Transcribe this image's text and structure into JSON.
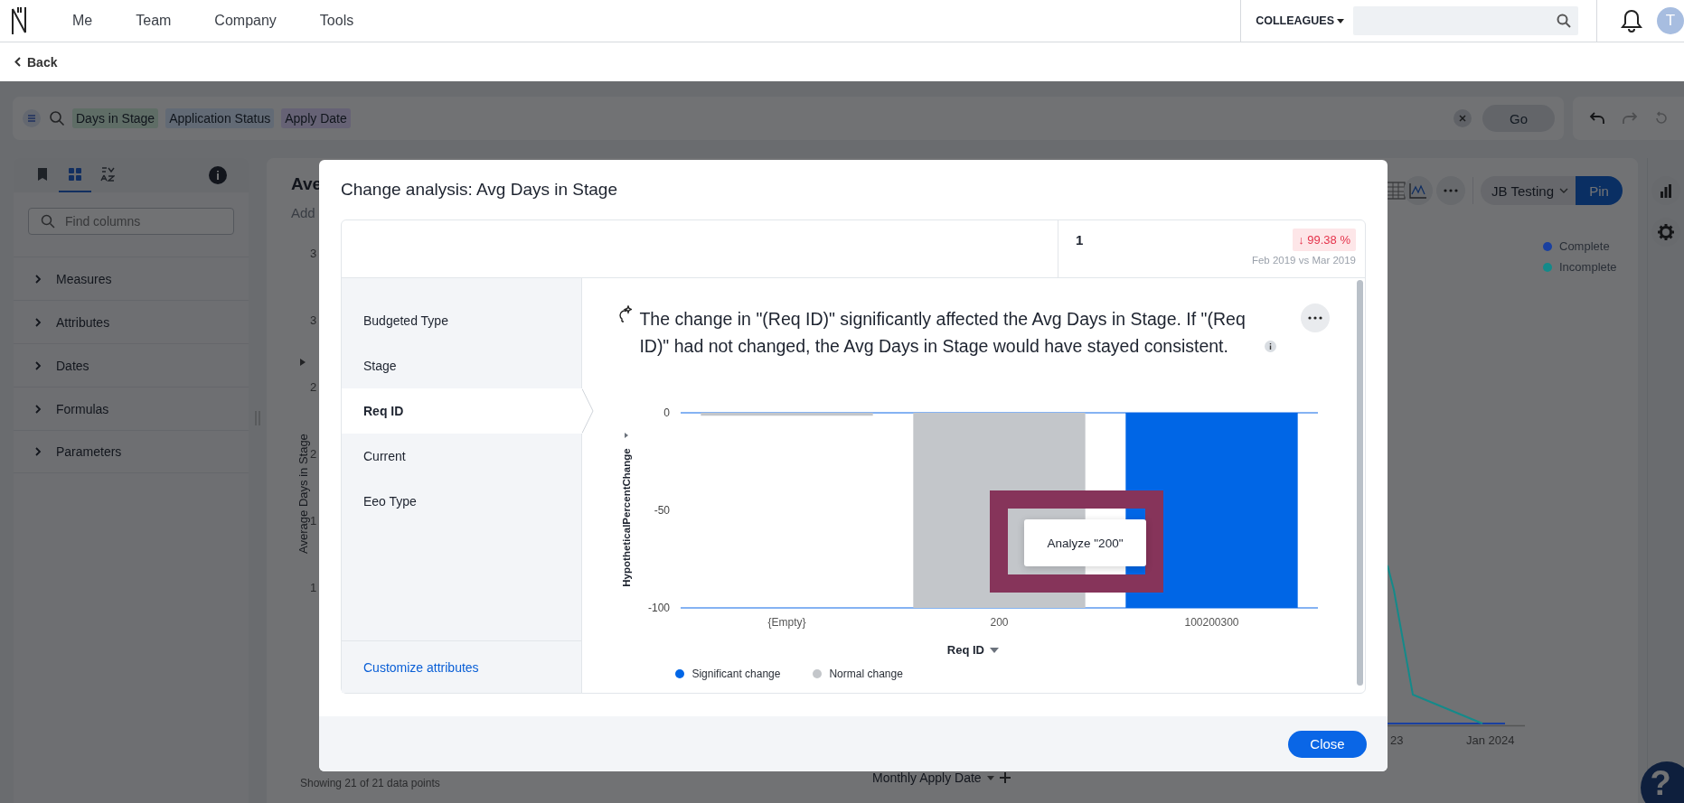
{
  "top_nav": {
    "menu": [
      "Me",
      "Team",
      "Company",
      "Tools"
    ],
    "colleagues": "COLLEAGUES",
    "avatar": "T"
  },
  "back": "Back",
  "search_bar": {
    "tokens": [
      {
        "label": "Days in Stage",
        "color": "#5f6d66"
      },
      {
        "label": "Application Status",
        "color": "#626a75"
      },
      {
        "label": "Apply Date",
        "color": "#666275"
      }
    ],
    "go": "Go"
  },
  "left_panel": {
    "tabs": [
      {
        "kind": "bookmark",
        "selected": false
      },
      {
        "kind": "grid",
        "selected": true
      },
      {
        "kind": "sort",
        "selected": false
      }
    ],
    "search": {
      "placeholder": "Find columns"
    },
    "sections": [
      {
        "label": "Measures",
        "expanded": false
      },
      {
        "label": "Attributes",
        "expanded": false
      },
      {
        "label": "Dates",
        "expanded": false
      },
      {
        "label": "Formulas",
        "expanded": false
      },
      {
        "label": "Parameters",
        "expanded": false
      }
    ]
  },
  "answer": {
    "title": "Ave",
    "subtitle": "Add",
    "view": "JB Testing",
    "pin": "Pin",
    "y_axis_label": "Average Days in Stage",
    "y_ticks": [
      "3",
      "3",
      "2",
      "2",
      "1",
      "1"
    ],
    "legend": [
      {
        "label": "Complete",
        "color": "#1a40a0"
      },
      {
        "label": "Incomplete",
        "color": "#148a8a"
      }
    ],
    "x_ticks": [
      "23",
      "Jan 2024"
    ],
    "x_axis_label": "Monthly Apply Date",
    "footer": "Showing 21 of 21 data points"
  },
  "help": "?",
  "modal": {
    "title": "Change analysis: Avg Days in Stage",
    "summary": {
      "value": "1",
      "change": "↓ 99.38 %",
      "period": "Feb 2019 vs Mar 2019"
    },
    "attributes": [
      {
        "label": "Budgeted Type",
        "selected": false
      },
      {
        "label": "Stage",
        "selected": false
      },
      {
        "label": "Req ID",
        "selected": true
      },
      {
        "label": "Current",
        "selected": false
      },
      {
        "label": "Eeo Type",
        "selected": false
      }
    ],
    "customize": "Customize attributes",
    "insight": "The change in \"(Req ID)\" significantly affected the Avg Days in Stage. If \"(Req ID)\" had not changed, the Avg Days in Stage would have stayed consistent.",
    "chart_data": {
      "type": "bar",
      "xlabel": "Req ID",
      "ylabel": "HypotheticalPercentChange",
      "categories": [
        "{Empty}",
        "200",
        "100200300"
      ],
      "series": [
        {
          "name": "Significant change",
          "color": "#0066e6",
          "values": [
            null,
            null,
            -100
          ]
        },
        {
          "name": "Normal change",
          "color": "#c3c6ca",
          "values": [
            -1.5,
            -100,
            null
          ]
        }
      ],
      "ylim": [
        -100,
        0
      ],
      "yticks": [
        0,
        -50,
        -100
      ],
      "legend": "bottom"
    },
    "tooltip": "Analyze \"200\"",
    "close": "Close"
  }
}
